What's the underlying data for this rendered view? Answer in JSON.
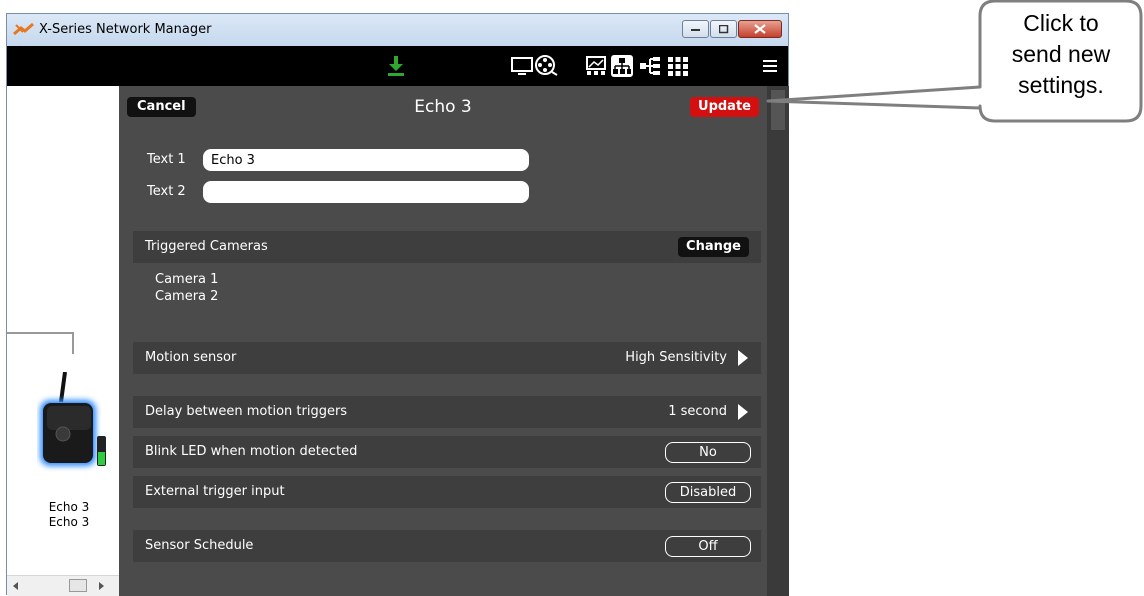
{
  "window": {
    "title": "X-Series Network Manager"
  },
  "toolbar": {
    "icons": [
      "download-icon",
      "monitor-icon",
      "film-reel-icon",
      "image-grid-icon",
      "network-tree-icon",
      "topology-icon",
      "grid-icon",
      "menu-icon"
    ]
  },
  "left_panel": {
    "device_labels": [
      "Echo 3",
      "Echo 3"
    ]
  },
  "dialog": {
    "cancel_label": "Cancel",
    "title": "Echo 3",
    "update_label": "Update",
    "text1_label": "Text 1",
    "text1_value": "Echo 3",
    "text2_label": "Text 2",
    "text2_value": "",
    "triggered_cameras": {
      "label": "Triggered Cameras",
      "change_label": "Change",
      "cameras": [
        "Camera 1",
        "Camera 2"
      ]
    },
    "rows": {
      "motion_sensor": {
        "label": "Motion sensor",
        "value": "High Sensitivity"
      },
      "delay": {
        "label": "Delay between motion triggers",
        "value": "1 second"
      },
      "blink_led": {
        "label": "Blink LED when motion detected",
        "value": "No"
      },
      "external_trigger": {
        "label": "External trigger input",
        "value": "Disabled"
      },
      "sensor_schedule": {
        "label": "Sensor Schedule",
        "value": "Off"
      }
    }
  },
  "callout": {
    "lines": [
      "Click to",
      "send new",
      "settings."
    ]
  },
  "colors": {
    "update_red": "#d40f0f",
    "download_green": "#2ea82e",
    "dialog_bg": "#4b4b4b"
  }
}
